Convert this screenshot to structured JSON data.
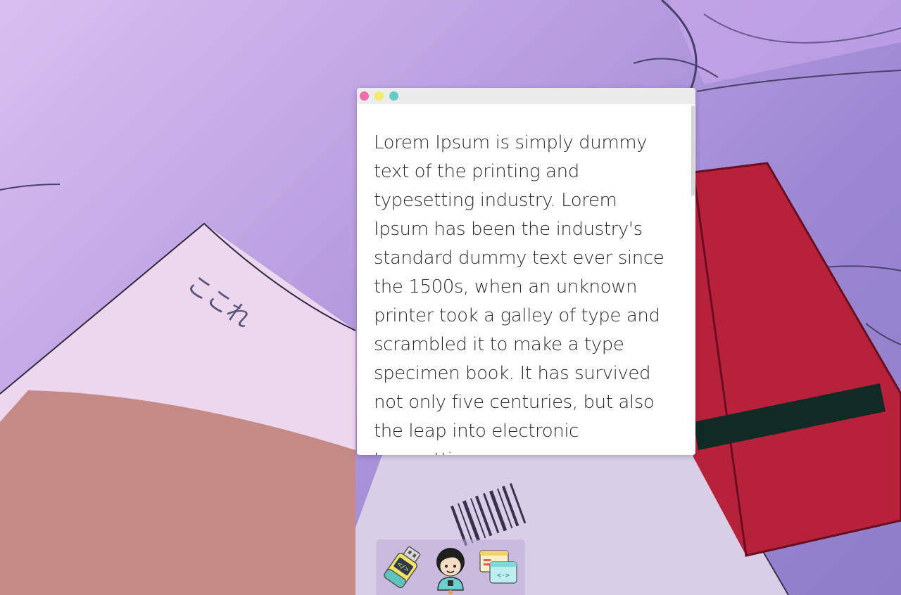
{
  "window": {
    "controls": {
      "close_color": "#f06ea8",
      "minimize_color": "#f2ec6b",
      "maximize_color": "#67cbc6"
    },
    "body_text": "Lorem Ipsum is simply dummy text of the printing and typesetting industry. Lorem Ipsum has been the industry's standard dummy text ever since the 1500s, when an unknown printer took a galley of type and scrambled it to make a type specimen book. It has survived not only five centuries, but also the leap into electronic typesetting"
  },
  "wallpaper": {
    "notebook_label": "ここれ"
  },
  "dock": {
    "items": [
      {
        "icon": "usb-drive-code-icon",
        "active": false
      },
      {
        "icon": "avatar-icon",
        "active": true
      },
      {
        "icon": "code-window-icon",
        "active": false
      }
    ],
    "active_indicator_color": "#f2a03a"
  }
}
